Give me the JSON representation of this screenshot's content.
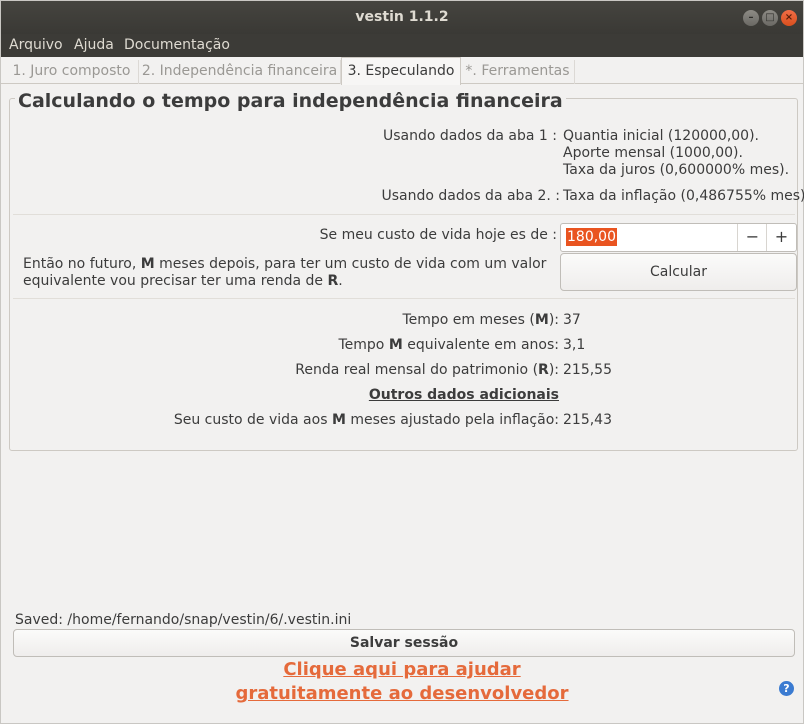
{
  "window": {
    "title": "vestin 1.1.2"
  },
  "menu": [
    "Arquivo",
    "Ajuda",
    "Documentação"
  ],
  "tabs": [
    "1. Juro composto",
    "2. Independência financeira",
    "3. Especulando",
    "*. Ferramentas"
  ],
  "active_tab": "3. Especulando",
  "panel": {
    "title": "Calculando o tempo para independência financeira",
    "tab1_label": "Usando dados da aba 1 :",
    "tab1_values": [
      "Quantia inicial (120000,00).",
      "Aporte mensal (1000,00).",
      "Taxa da juros (0,600000% mes)."
    ],
    "tab2_label": "Usando dados da aba 2. :",
    "tab2_value": "Taxa da inflação (0,486755% mes).",
    "cost_label": "Se meu custo de vida hoje es de :",
    "cost_value": "180,00",
    "minus": "−",
    "plus": "+",
    "future_text_1": "Então no futuro,",
    "future_M": "M",
    "future_text_2": "meses depois, para ter um custo de vida com um valor",
    "future_text_3": "equivalente vou precisar ter uma renda de",
    "future_R": "R",
    "future_dot": ".",
    "calc_button": "Calcular",
    "results": {
      "months_label_a": "Tempo em meses (",
      "months_label_b": "M",
      "months_label_c": "):",
      "months_value": "37",
      "years_label_a": "Tempo",
      "years_label_b": "M",
      "years_label_c": "equivalente em anos:",
      "years_value": "3,1",
      "income_label_a": "Renda real mensal do patrimonio (",
      "income_label_b": "R",
      "income_label_c": "):",
      "income_value": "215,55",
      "extra_header": "Outros dados adicionais",
      "adjusted_label_a": "Seu custo de vida aos",
      "adjusted_label_b": "M",
      "adjusted_label_c": "meses ajustado pela inflação:",
      "adjusted_value": "215,43"
    }
  },
  "status": "Saved: /home/fernando/snap/vestin/6/.vestin.ini",
  "save_button": "Salvar sessão",
  "donate_line1": "Clique aqui para ajudar",
  "donate_line2": "gratuitamente ao desenvolvedor",
  "help_glyph": "?",
  "colors": {
    "accent": "#e95420",
    "donate": "#e56a3b",
    "titlebar": "#3c3b37",
    "help": "#3b7bd1"
  }
}
